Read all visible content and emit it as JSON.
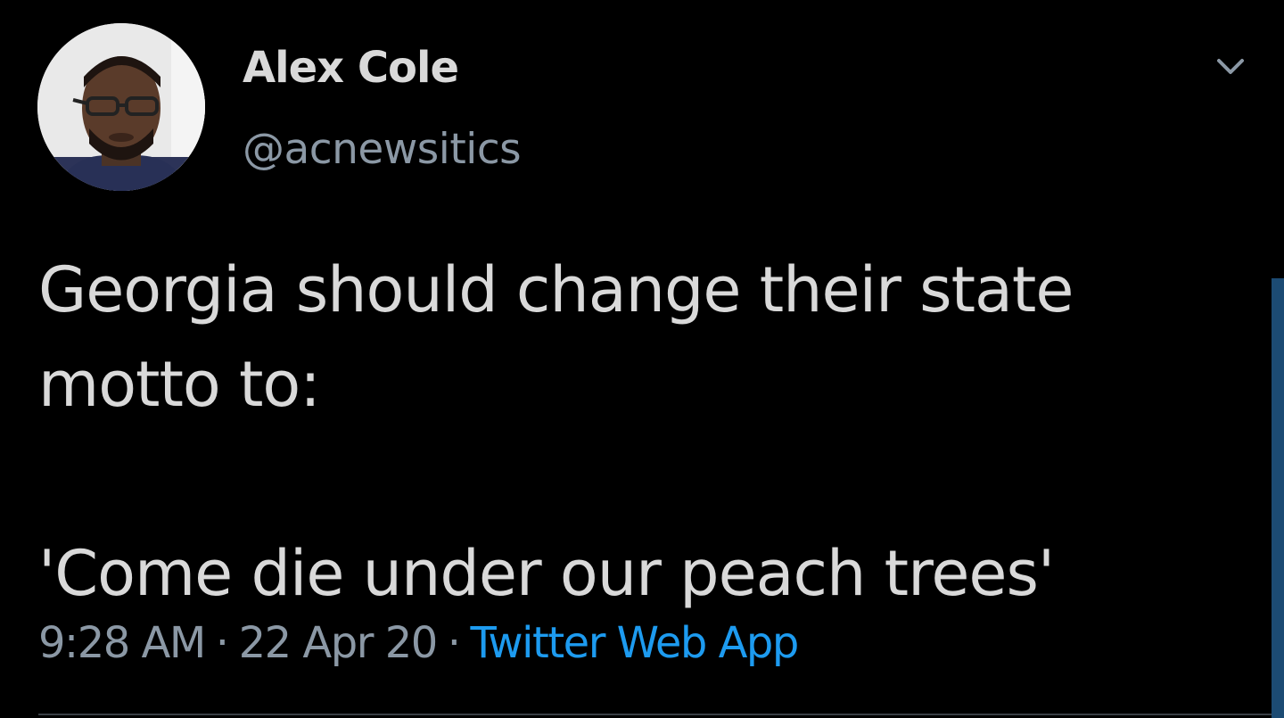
{
  "tweet": {
    "author": {
      "display_name": "Alex Cole",
      "handle": "@acnewsitics",
      "avatar_icon": "user-avatar-photo"
    },
    "text": "Georgia should change their state motto to:\n\n'Come die under our peach trees'",
    "time": "9:28 AM",
    "separator": "·",
    "date": "22 Apr 20",
    "source": "Twitter Web App",
    "menu_icon": "chevron-down-icon"
  },
  "colors": {
    "background": "#000000",
    "primary_text": "#d9d9d9",
    "secondary_text": "#8b98a5",
    "link": "#1d9bf0",
    "scrollbar": "#1c4b73"
  }
}
